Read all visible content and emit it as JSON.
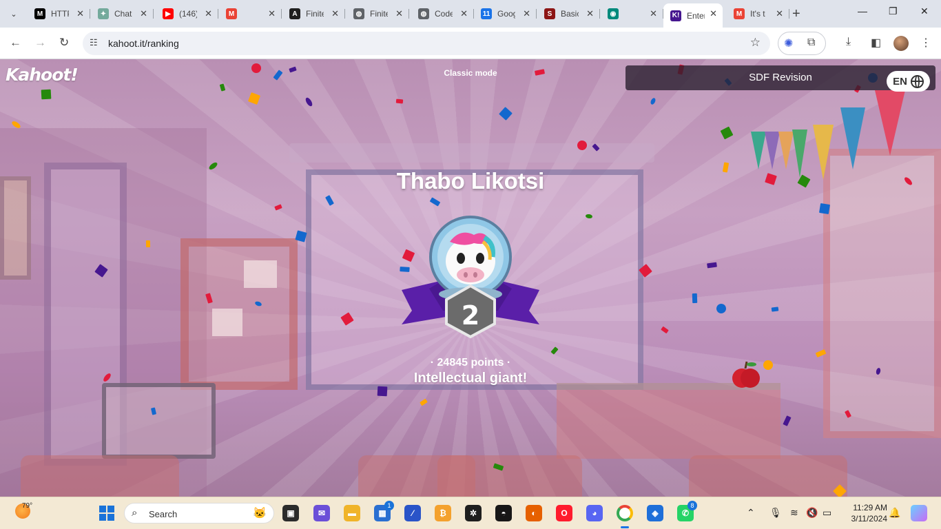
{
  "browser": {
    "tabs": [
      {
        "title": "HTTP",
        "icon": "notion-icon",
        "color": "#000000",
        "glyph": "M"
      },
      {
        "title": "ChatGPT",
        "icon": "chatgpt-icon",
        "color": "#74aa9c",
        "glyph": "✦"
      },
      {
        "title": "(146)",
        "icon": "youtube-icon",
        "color": "#ff0000",
        "glyph": "▶"
      },
      {
        "title": "",
        "icon": "gmail-icon",
        "color": "#ea4335",
        "glyph": "M"
      },
      {
        "title": "Finite",
        "icon": "anthropic-icon",
        "color": "#1f1f1f",
        "glyph": "A"
      },
      {
        "title": "Finite",
        "icon": "web-icon",
        "color": "#5f6368",
        "glyph": "◍"
      },
      {
        "title": "Code",
        "icon": "web-icon",
        "color": "#5f6368",
        "glyph": "◍"
      },
      {
        "title": "Google",
        "icon": "calendar-icon",
        "color": "#1a73e8",
        "glyph": "11"
      },
      {
        "title": "Basic",
        "icon": "stanford-icon",
        "color": "#8c1515",
        "glyph": "S"
      },
      {
        "title": "",
        "icon": "meet-icon",
        "color": "#00897b",
        "glyph": "◉"
      },
      {
        "title": "Enter",
        "icon": "kahoot-icon",
        "color": "#46178f",
        "glyph": "K!"
      },
      {
        "title": "It's t",
        "icon": "gmail-icon",
        "color": "#ea4335",
        "glyph": "M"
      }
    ],
    "url": "kahoot.it/ranking"
  },
  "kahoot": {
    "logo": "Kahoot!",
    "mode": "Classic mode",
    "quiz_title": "SDF Revision",
    "language": "EN",
    "player_name": "Thabo Likotsi",
    "rank": "2",
    "points": "· 24845 points ·",
    "award": "Intellectual giant!",
    "avatar": "unicorn-astronaut-icon"
  },
  "colors": {
    "kahoot_purple": "#46178f",
    "ribbon_purple": "#5a1fa8",
    "badge_gray": "#6b6b6b"
  },
  "taskbar": {
    "weather_temp": "79°",
    "search_label": "Search",
    "store_badge": "1",
    "whatsapp_badge": "8",
    "time": "11:29 AM",
    "date": "3/11/2024"
  }
}
